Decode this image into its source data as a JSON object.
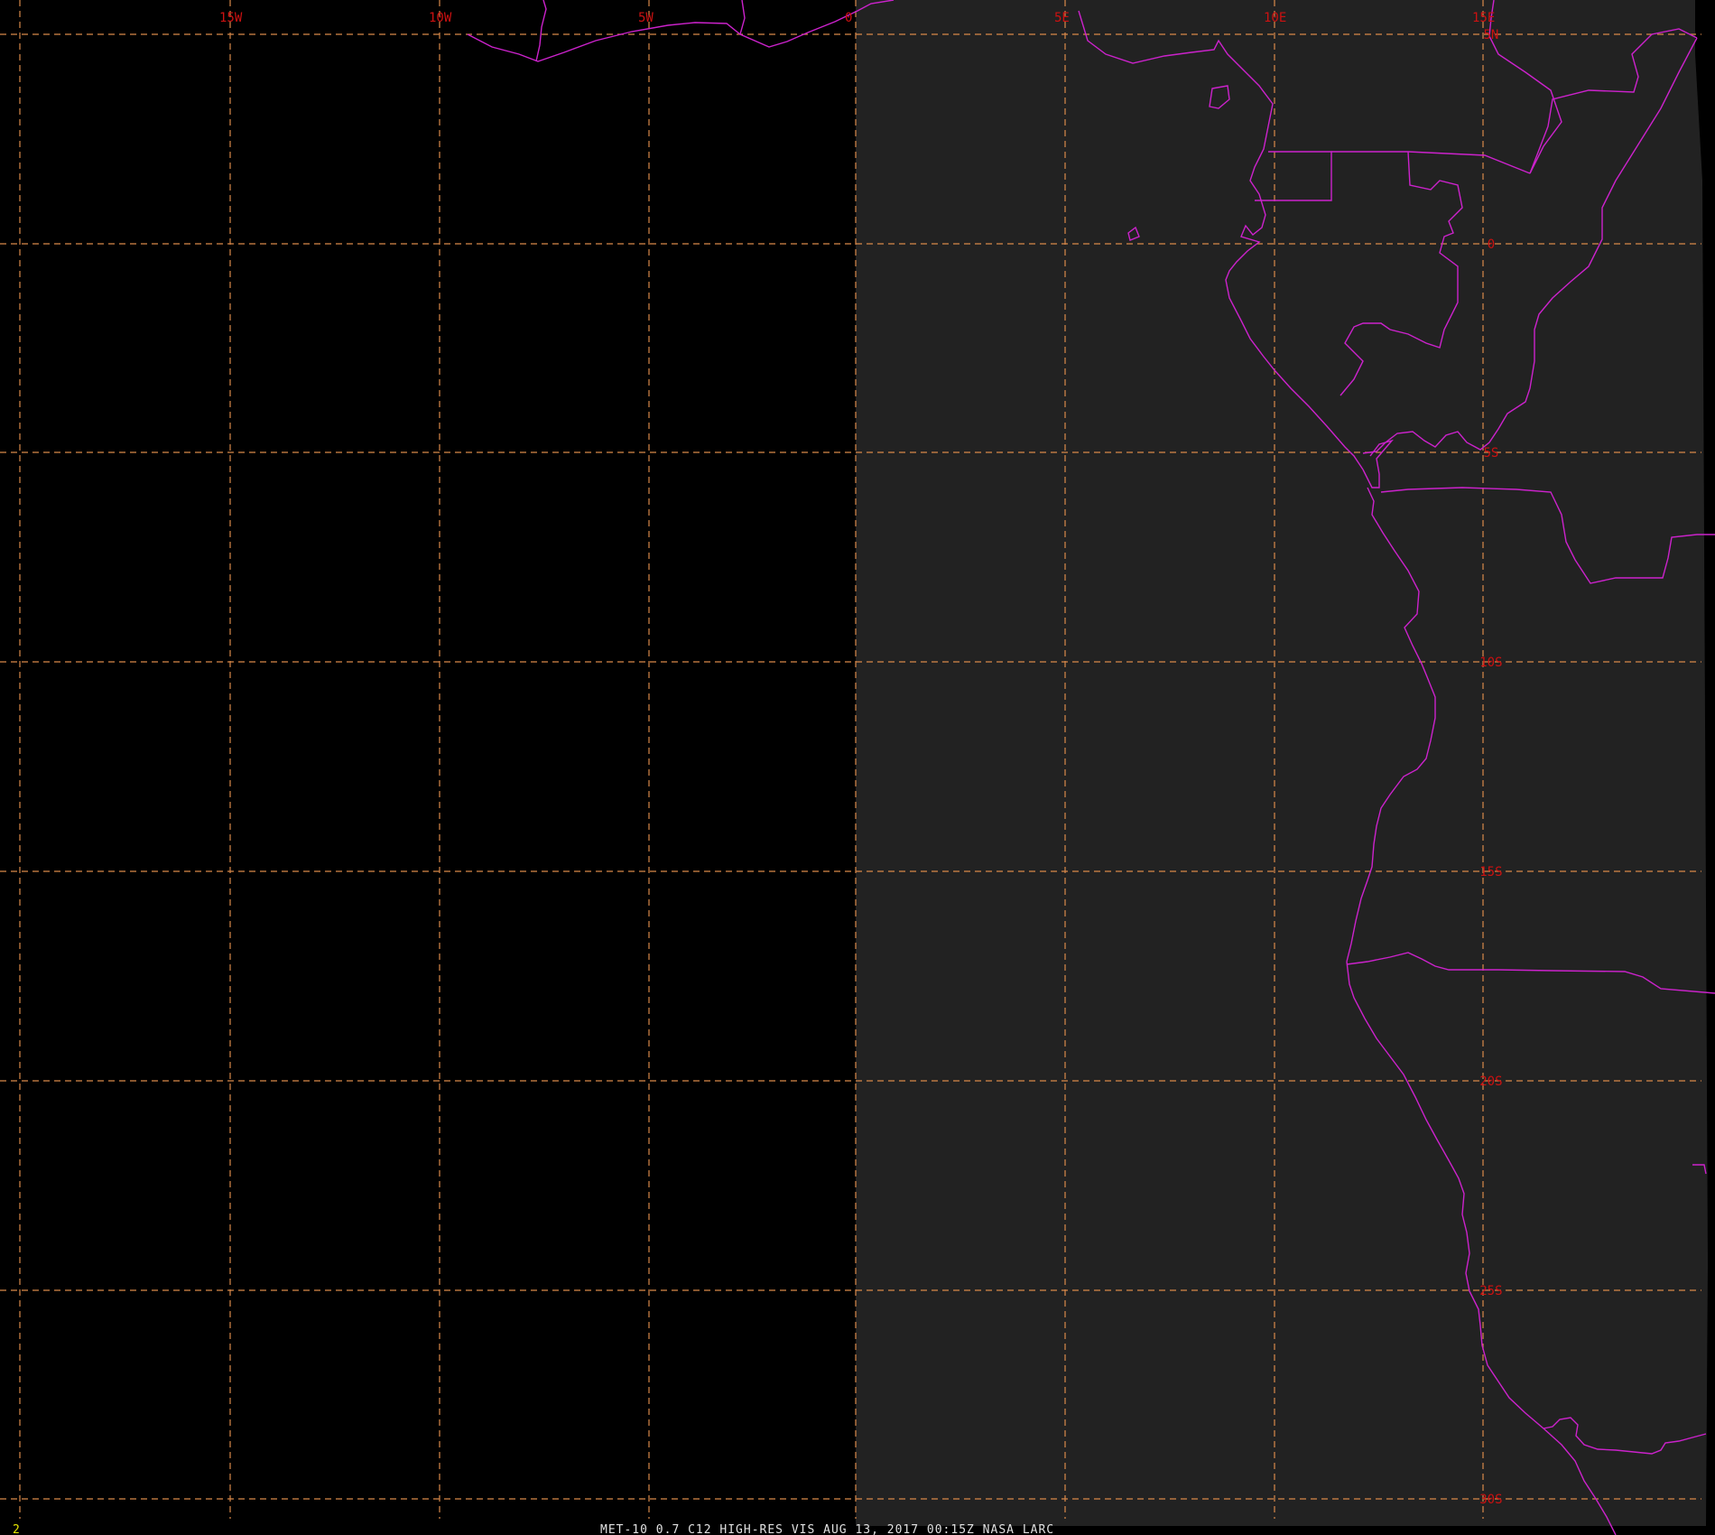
{
  "colors": {
    "background": "#000000",
    "satellite_coverage": "#222222",
    "grid": "#d9894a",
    "grid_label": "#cc1111",
    "coastline": "#cc22cc",
    "caption": "#e0e0e0",
    "frame_number": "#e6e600"
  },
  "grid": {
    "longitudes": [
      "15W",
      "10W",
      "5W",
      "0",
      "5E",
      "10E",
      "15E"
    ],
    "latitudes": [
      "5N",
      "0",
      "5S",
      "10S",
      "15S",
      "20S",
      "25S",
      "30S"
    ]
  },
  "frame_number": "2",
  "caption": "MET-10 0.7 C12 HIGH-RES VIS   AUG 13, 2017 00:15Z    NASA LARC"
}
